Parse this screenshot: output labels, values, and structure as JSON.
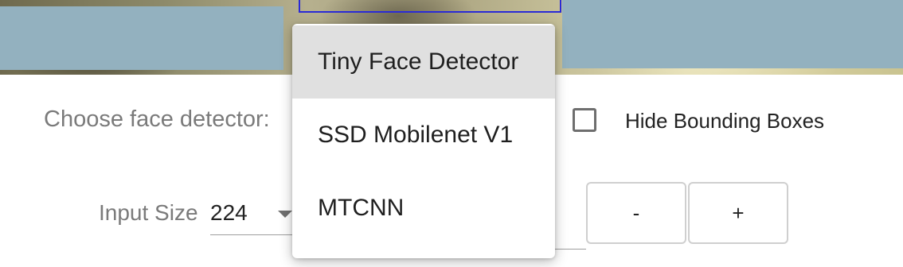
{
  "detector": {
    "label": "Choose face detector:",
    "options": [
      {
        "label": "Tiny Face Detector",
        "selected": true
      },
      {
        "label": "SSD Mobilenet V1",
        "selected": false
      },
      {
        "label": "MTCNN",
        "selected": false
      }
    ]
  },
  "hide_boxes": {
    "label": "Hide Bounding Boxes",
    "checked": false
  },
  "input_size": {
    "label": "Input Size",
    "value": "224"
  },
  "buttons": {
    "decrease_label": "-",
    "increase_label": "+"
  },
  "colors": {
    "overlay": "#93b1bf",
    "detection_box": "#2a2ad6",
    "selected_item_bg": "#e0e0e0"
  }
}
